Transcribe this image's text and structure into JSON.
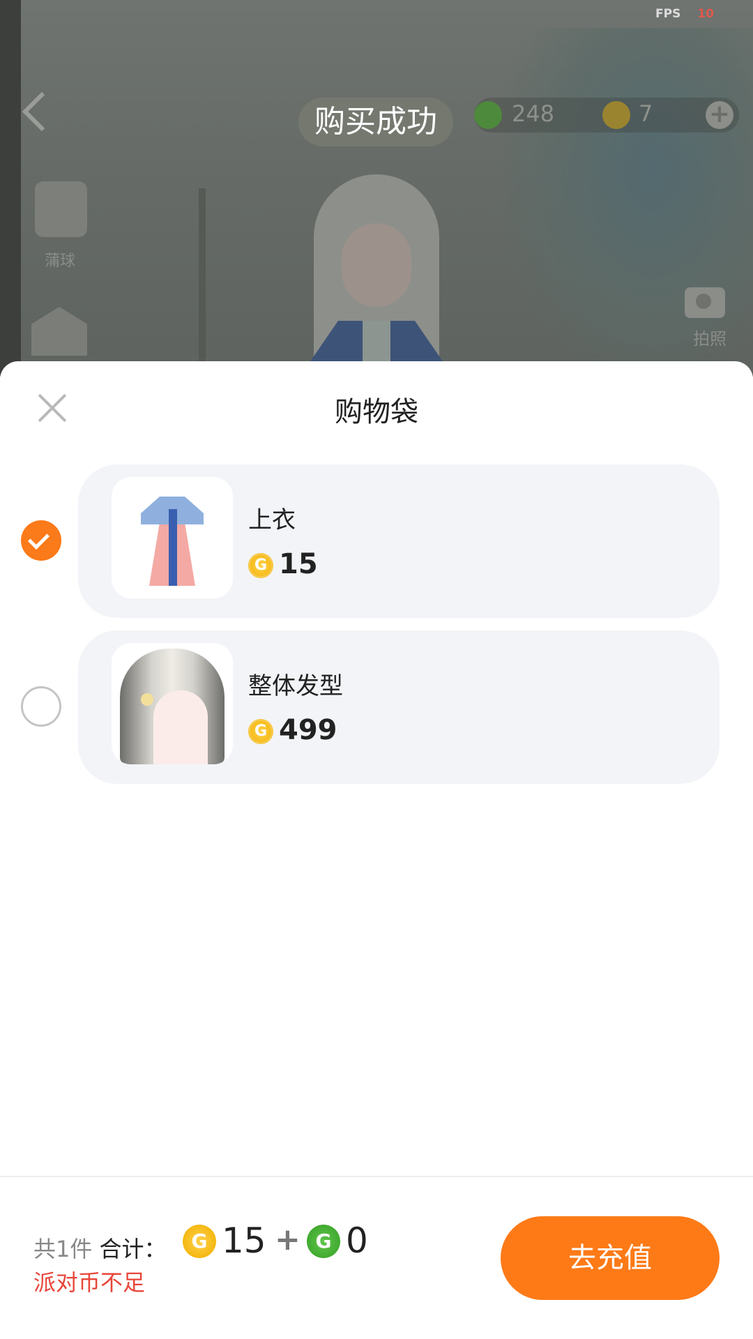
{
  "colors": {
    "accent": "#fd7a17",
    "warning": "#e8463a",
    "gold_coin": "#f5b813",
    "green_coin": "#3fa82e"
  },
  "hud": {
    "fps_label": "FPS",
    "fps_value": "10",
    "toast": "购买成功",
    "green_currency": "248",
    "gold_currency": "7",
    "cactus_label": "蒲球",
    "camera_label": "拍照"
  },
  "sheet": {
    "title": "购物袋",
    "items": [
      {
        "name": "上衣",
        "price": "15",
        "price_icon": "gold-coin-icon",
        "checked": true
      },
      {
        "name": "整体发型",
        "price": "499",
        "price_icon": "gold-coin-icon",
        "checked": false
      }
    ]
  },
  "footer": {
    "count_label": "共1件",
    "total_label": "合计：",
    "gold_total": "15",
    "plus": "+",
    "green_total": "0",
    "warning": "派对币不足",
    "recharge_label": "去充值"
  }
}
